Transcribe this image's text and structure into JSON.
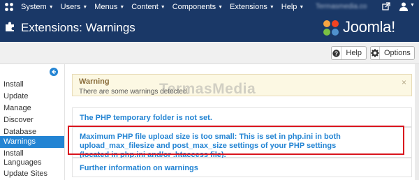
{
  "topbar": {
    "menu": [
      "System",
      "Users",
      "Menus",
      "Content",
      "Components",
      "Extensions",
      "Help"
    ],
    "site_link": "Termasmedia.co"
  },
  "header": {
    "title": "Extensions: Warnings",
    "brand": "Joomla!"
  },
  "toolbar": {
    "help_label": "Help",
    "options_label": "Options"
  },
  "sidebar": {
    "items": [
      {
        "label": "Install",
        "active": false
      },
      {
        "label": "Update",
        "active": false
      },
      {
        "label": "Manage",
        "active": false
      },
      {
        "label": "Discover",
        "active": false
      },
      {
        "label": "Database",
        "active": false
      },
      {
        "label": "Warnings",
        "active": true
      },
      {
        "label": "Install",
        "active": false
      },
      {
        "label": "Languages",
        "active": false
      },
      {
        "label": "Update Sites",
        "active": false
      }
    ]
  },
  "alert": {
    "title": "Warning",
    "message": "There are some warnings detected.",
    "close": "×"
  },
  "warnings": [
    {
      "text": "The PHP temporary folder is not set."
    },
    {
      "text": "Maximum PHP file upload size is too small: This is set in php.ini in both upload_max_filesize and post_max_size settings of your PHP settings (located in php.ini and/or .htaccess file)."
    },
    {
      "text": "Further information on warnings"
    }
  ],
  "watermark": "TermasMedia",
  "colors": {
    "navbar": "#1a3867",
    "accent": "#2384d3",
    "highlight": "#d9141d",
    "warning_bg": "#fcf8e3"
  }
}
